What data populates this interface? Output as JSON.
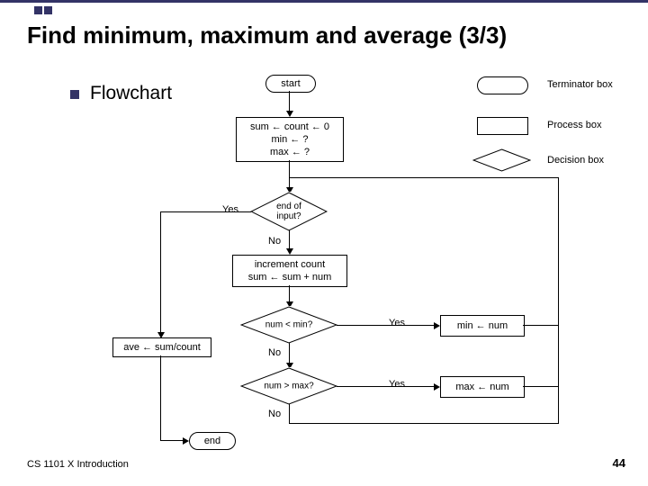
{
  "title": "Find minimum, maximum and average (3/3)",
  "subtitle": "Flowchart",
  "legend": {
    "terminator": "Terminator box",
    "process": "Process box",
    "decision": "Decision box"
  },
  "nodes": {
    "start": "start",
    "init_line1": "sum ← count ← 0",
    "init_line2": "min ← ?",
    "init_line3": "max ← ?",
    "endinput_l1": "end of",
    "endinput_l2": "input?",
    "inc_l1": "increment count",
    "inc_l2": "sum ← sum + num",
    "lt": "num < min?",
    "gt": "num > max?",
    "setmin": "min ← num",
    "setmax": "max ← num",
    "ave": "ave ← sum/count",
    "end": "end"
  },
  "labels": {
    "yes": "Yes",
    "no": "No"
  },
  "footer": {
    "left": "CS 1101 X Introduction",
    "right": "44"
  }
}
